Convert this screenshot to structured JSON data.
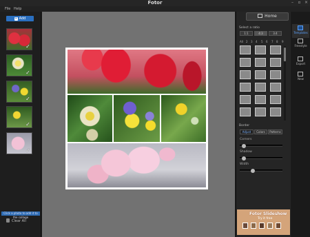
{
  "window": {
    "title": "Fotor"
  },
  "menu": {
    "items": [
      "File",
      "Help"
    ]
  },
  "left": {
    "add_label": "Add",
    "hint": "Click a photo to add it to the collage",
    "clear_label": "Clear All"
  },
  "right": {
    "home_label": "Home",
    "ratio_label": "Select a ratio",
    "ratios": [
      "1:1",
      "4:3",
      "3:4"
    ],
    "count_row": [
      "All",
      "2",
      "3",
      "4",
      "5",
      "6",
      "7",
      "8",
      "9"
    ],
    "border_label": "Border",
    "border_tabs": [
      "Adjust",
      "Colors",
      "Patterns"
    ],
    "sliders": [
      {
        "label": "Corners",
        "value": 0.05
      },
      {
        "label": "Shadow",
        "value": 0.05
      },
      {
        "label": "Width",
        "value": 0.28
      }
    ],
    "ad": {
      "title": "Fotor Slideshow",
      "subtitle": "Try it free"
    }
  },
  "sidebar": {
    "items": [
      {
        "label": "Templates",
        "icon": "templates-icon"
      },
      {
        "label": "Freestyle",
        "icon": "freestyle-icon"
      },
      {
        "label": "Export",
        "icon": "export-icon"
      },
      {
        "label": "New",
        "icon": "new-icon"
      }
    ]
  },
  "colors": {
    "accent": "#2a6fc0",
    "canvas": "#727272",
    "panel": "#252525"
  }
}
